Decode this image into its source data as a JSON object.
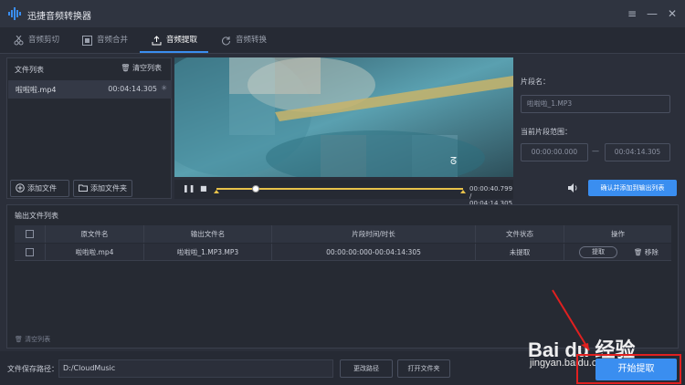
{
  "app": {
    "title": "迅捷音频转换器"
  },
  "window": {
    "menu_icon": "menu-icon",
    "minimize_icon": "minimize-icon",
    "close_icon": "close-icon"
  },
  "tabs": [
    {
      "label": "音频剪切",
      "icon": "scissors-icon"
    },
    {
      "label": "音频合并",
      "icon": "merge-icon"
    },
    {
      "label": "音频提取",
      "icon": "upload-icon"
    },
    {
      "label": "音频转换",
      "icon": "refresh-icon"
    }
  ],
  "active_tab": "音频提取",
  "file_list": {
    "title": "文件列表",
    "clear_label": "清空列表",
    "files": [
      {
        "name": "啦啦啦.mp4",
        "duration": "00:04:14.305"
      }
    ],
    "add_file_label": "添加文件",
    "add_folder_label": "添加文件夹"
  },
  "player": {
    "current_time": "00:00:40.799",
    "separator": "/",
    "total_time": "00:04:14.305",
    "progress": 0.16
  },
  "segment": {
    "name_label": "片段名：",
    "name_value": "啦啦啦_1.MP3",
    "range_label": "当前片段范围：",
    "start": "00:00:00.000",
    "dash": "—",
    "end": "00:04:14.305",
    "confirm_label": "确认并添加到输出列表"
  },
  "output_list": {
    "title": "输出文件列表",
    "columns": [
      "原文件名",
      "输出文件名",
      "片段时间/时长",
      "文件状态",
      "操作"
    ],
    "rows": [
      {
        "source": "啦啦啦.mp4",
        "output": "啦啦啦_1.MP3.MP3",
        "range": "00:00:00:000-00:04:14:305",
        "status": "未提取",
        "extract_label": "提取",
        "remove_label": "移除"
      }
    ],
    "clear_label": "清空列表"
  },
  "bottom": {
    "path_label": "文件保存路径：",
    "path_value": "D:/CloudMusic",
    "change_path_label": "更改路径",
    "open_folder_label": "打开文件夹",
    "start_label": "开始提取"
  },
  "watermark": {
    "brand": "Bai du 经验",
    "url": "jingyan.baidu.com"
  },
  "colors": {
    "accent": "#3a8ef0",
    "highlight": "#e02020",
    "track": "#e8c24a"
  }
}
